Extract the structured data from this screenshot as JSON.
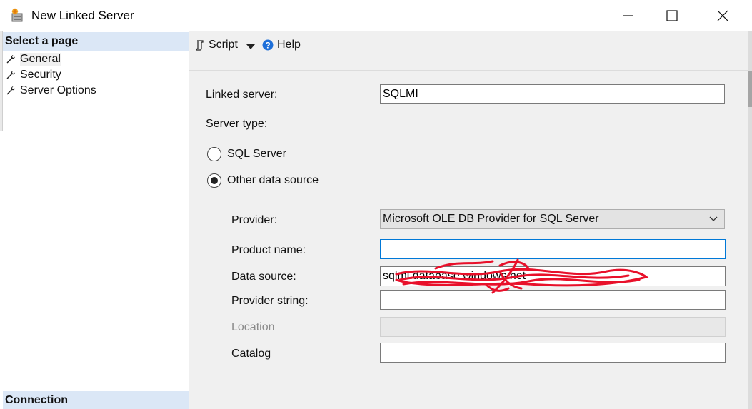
{
  "window": {
    "title": "New Linked Server",
    "icon": "linked-server-icon",
    "controls": {
      "minimize": "minimize-icon",
      "maximize": "maximize-icon",
      "close": "close-icon"
    }
  },
  "sidebar": {
    "select_page_header": "Select a page",
    "items": [
      {
        "label": "General",
        "icon": "wrench-icon",
        "selected": true
      },
      {
        "label": "Security",
        "icon": "wrench-icon",
        "selected": false
      },
      {
        "label": "Server Options",
        "icon": "wrench-icon",
        "selected": false
      }
    ],
    "connection_header": "Connection"
  },
  "toolbar": {
    "script_label": "Script",
    "help_label": "Help"
  },
  "form": {
    "linked_server_label": "Linked server:",
    "linked_server_value": "SQLMI",
    "server_type_label": "Server type:",
    "radio_sql_server": "SQL Server",
    "radio_other": "Other data source",
    "selected_server_type": "Other data source",
    "provider_label": "Provider:",
    "provider_value": "Microsoft OLE DB Provider for SQL Server",
    "product_name_label": "Product name:",
    "product_name_value": "",
    "data_source_label": "Data source:",
    "data_source_value": "sqlmi.database.windows.net",
    "provider_string_label": "Provider string:",
    "provider_string_value": "",
    "location_label": "Location",
    "location_value": "",
    "catalog_label": "Catalog",
    "catalog_value": ""
  },
  "colors": {
    "section_header_bg": "#dbe7f6",
    "focus_border": "#0078d7",
    "help_icon": "#1e6fd9",
    "redaction_scribble": "#e8102a"
  }
}
